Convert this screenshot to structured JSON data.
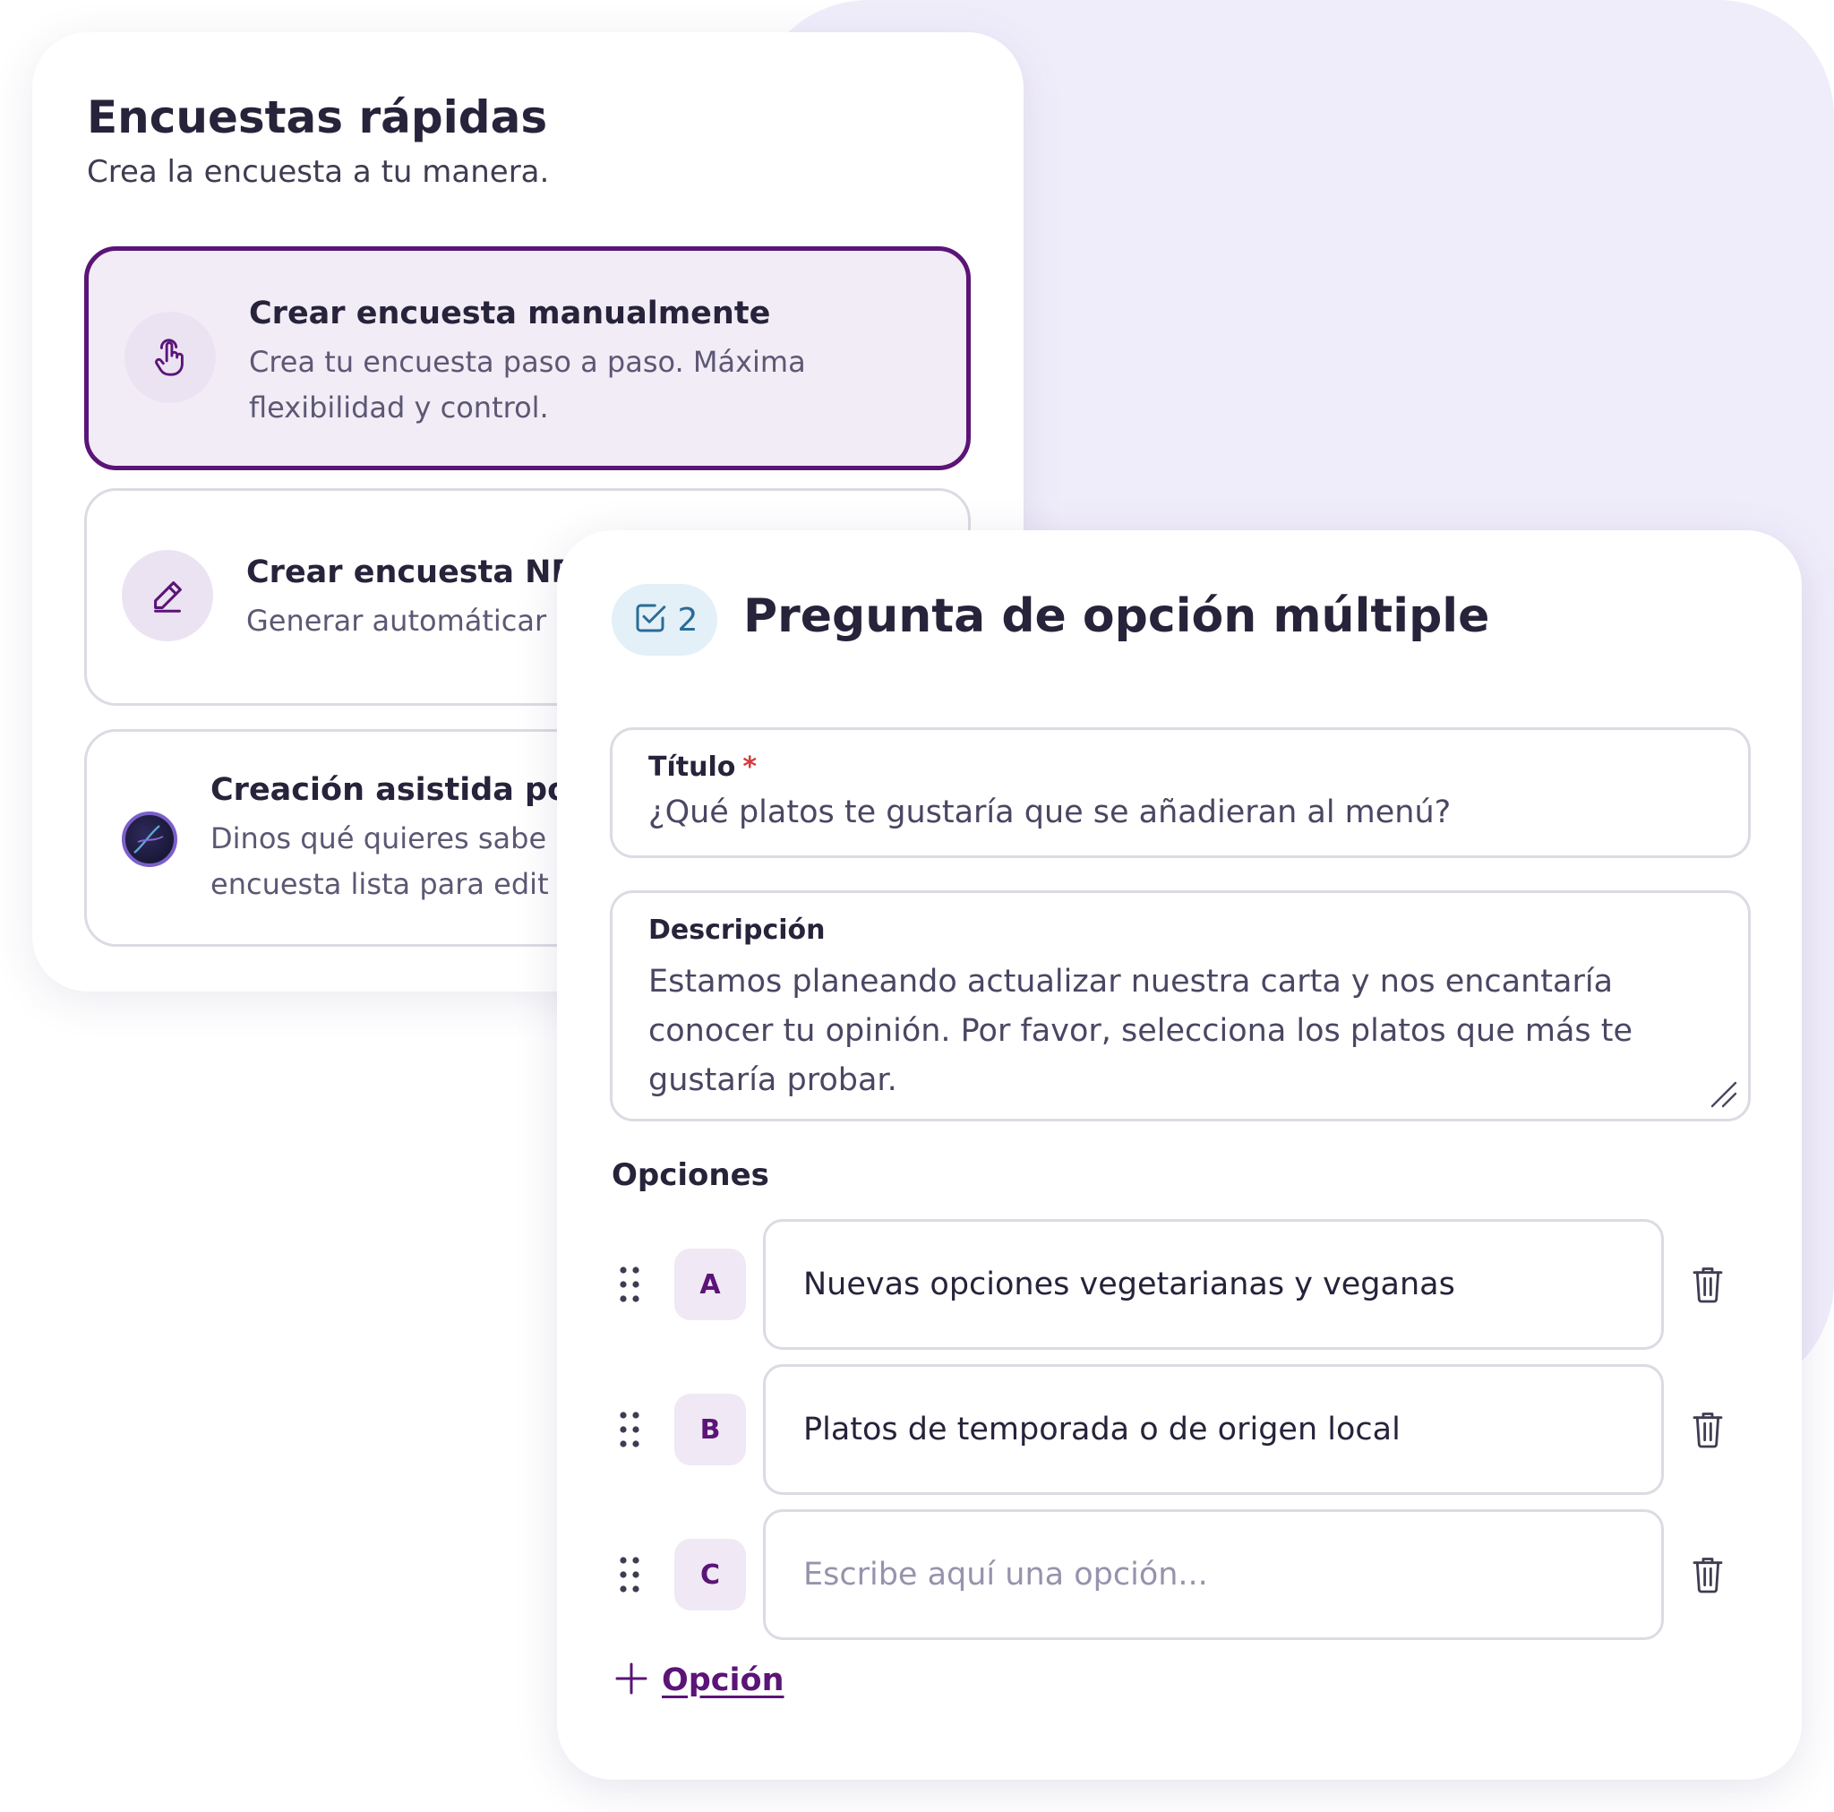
{
  "quick_surveys": {
    "title": "Encuestas rápidas",
    "subtitle": "Crea la encuesta a tu manera.",
    "options": [
      {
        "title": "Crear encuesta manualmente",
        "description": "Crea tu encuesta paso a paso. Máxima flexibilidad y control.",
        "icon": "hand-pointer-icon",
        "selected": true
      },
      {
        "title": "Crear encuesta NPS",
        "description": "Generar automáticar",
        "icon": "pencil-icon",
        "selected": false
      },
      {
        "title": "Creación asistida por",
        "description": "Dinos qué quieres sabe encuesta lista para edit",
        "icon": "ai-avatar-icon",
        "selected": false
      }
    ]
  },
  "question_editor": {
    "badge_number": "2",
    "badge_icon": "checkbox-check-icon",
    "heading": "Pregunta de opción múltiple",
    "title_field": {
      "label": "Título",
      "required_mark": "*",
      "value": "¿Qué platos te gustaría que se añadieran al menú?"
    },
    "description_field": {
      "label": "Descripción",
      "value": "Estamos planeando actualizar nuestra carta y nos encantaría conocer tu opinión. Por favor, selecciona los platos que más te gustaría probar."
    },
    "options_label": "Opciones",
    "options": [
      {
        "letter": "A",
        "value": "Nuevas opciones vegetarianas y veganas",
        "placeholder": ""
      },
      {
        "letter": "B",
        "value": "Platos de temporada o de origen local",
        "placeholder": ""
      },
      {
        "letter": "C",
        "value": "",
        "placeholder": "Escribe aquí una opción..."
      }
    ],
    "add_option_label": "Opción"
  },
  "colors": {
    "accent": "#5b1477",
    "background_blob": "#f0edfb",
    "badge_bg": "#e3f0f7",
    "badge_fg": "#2a6c98",
    "required": "#d63b3b"
  }
}
